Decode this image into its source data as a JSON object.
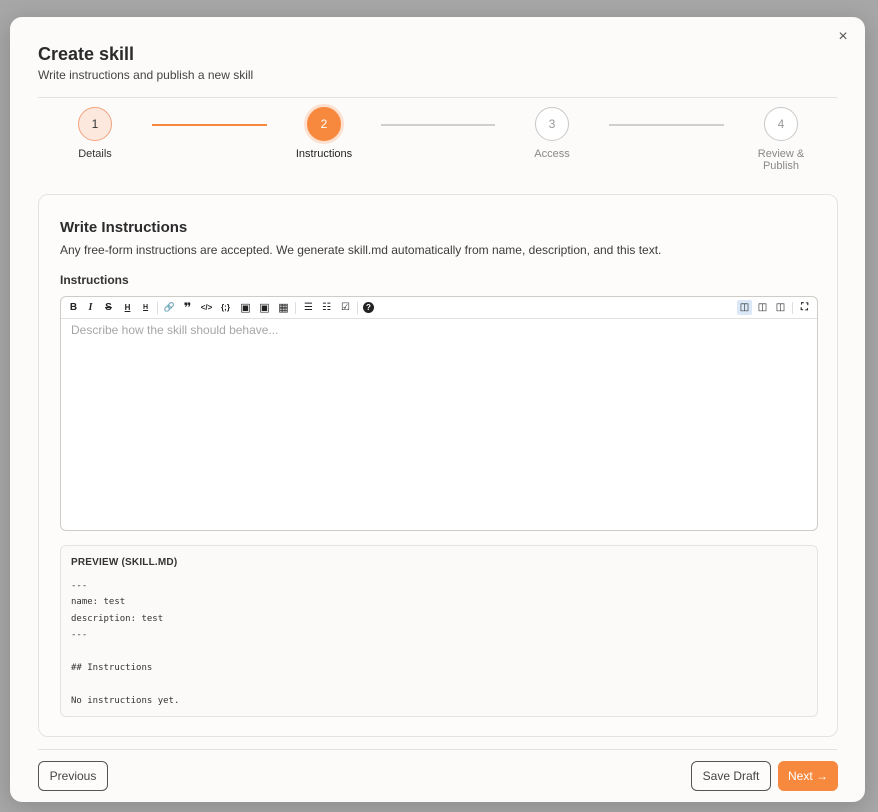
{
  "modal": {
    "title": "Create skill",
    "subtitle": "Write instructions and publish a new skill",
    "close_icon": "×"
  },
  "stepper": {
    "steps": [
      {
        "number": "1",
        "label": "Details",
        "state": "done"
      },
      {
        "number": "2",
        "label": "Instructions",
        "state": "active"
      },
      {
        "number": "3",
        "label": "Access",
        "state": "todo"
      },
      {
        "number": "4",
        "label": "Review & Publish",
        "state": "todo"
      }
    ],
    "colors": {
      "accent": "#f7893f",
      "inactive_line": "#cfcfcf"
    }
  },
  "card": {
    "title": "Write Instructions",
    "description": "Any free-form instructions are accepted. We generate skill.md automatically from name, description, and this text.",
    "field_label": "Instructions"
  },
  "editor": {
    "placeholder": "Describe how the skill should behave...",
    "toolbar": {
      "bold": "B",
      "italic": "I",
      "strike": "S",
      "heading_big": "H",
      "heading_small": "H",
      "link": "🔗",
      "quote": "❞",
      "code": "</>",
      "code_block": "{;}",
      "comment": "▣",
      "image": "▣",
      "table": "▦",
      "bullet_list": "☰",
      "numbered_list": "☷",
      "task_list": "☑",
      "help": "?",
      "side_by_side": "◫",
      "preview": "◫",
      "columns": "◫",
      "fullscreen": "⛶"
    }
  },
  "preview": {
    "title": "PREVIEW (SKILL.MD)",
    "lines": [
      "---",
      "name: test",
      "description: test",
      "---",
      "",
      "## Instructions",
      "",
      "No instructions yet."
    ]
  },
  "footer": {
    "previous": "Previous",
    "save_draft": "Save Draft",
    "next": "Next →"
  }
}
